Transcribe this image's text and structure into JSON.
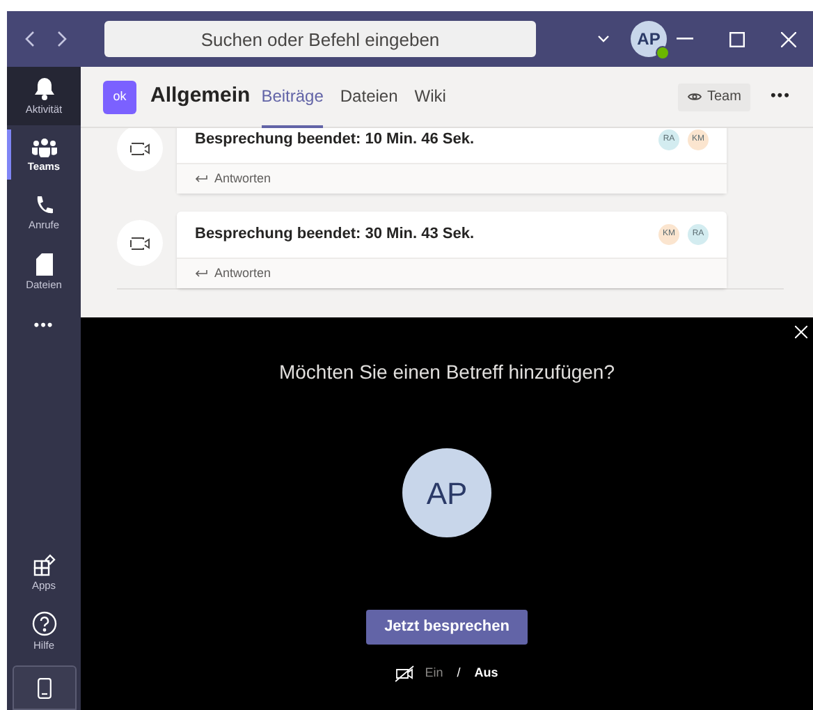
{
  "title_bar": {
    "search_placeholder": "Suchen oder Befehl eingeben",
    "avatar": "AP",
    "online": true
  },
  "sidebar": {
    "items": [
      {
        "kind": "bell",
        "label": "Aktivität",
        "selected": false,
        "hover": true
      },
      {
        "kind": "teams",
        "label": "Teams",
        "selected": true,
        "hover": false
      },
      {
        "kind": "phone",
        "label": "Anrufe",
        "selected": false,
        "hover": false
      },
      {
        "kind": "file",
        "label": "Dateien",
        "selected": false,
        "hover": false
      }
    ],
    "more": "•••",
    "bottom_items": [
      {
        "kind": "apps",
        "label": "Apps"
      },
      {
        "kind": "help",
        "label": "Hilfe"
      }
    ]
  },
  "channel": {
    "badge": "ok",
    "name": "Allgemein",
    "tabs": [
      {
        "label": "Beiträge",
        "selected": true
      },
      {
        "label": "Dateien",
        "selected": false
      },
      {
        "label": "Wiki",
        "selected": false
      }
    ],
    "team_button": "Team",
    "more": "•••"
  },
  "messages": [
    {
      "text": "Besprechung beendet: 10 Min. 46 Sek.",
      "reply": "Antworten",
      "participants": [
        {
          "initials": "RA",
          "color": "#d3ecf0"
        },
        {
          "initials": "KM",
          "color": "#fbe5cf"
        }
      ]
    },
    {
      "text": "Besprechung beendet: 30 Min. 43 Sek.",
      "reply": "Antworten",
      "participants": [
        {
          "initials": "KM",
          "color": "#fbe5cf"
        },
        {
          "initials": "RA",
          "color": "#d3ecf0"
        }
      ]
    }
  ],
  "overlay": {
    "question": "Möchten Sie einen Betreff hinzufügen?",
    "avatar": "AP",
    "button": "Jetzt besprechen",
    "camera": {
      "on_label": "Ein",
      "off_label": "Aus",
      "separator": "/",
      "on": false
    }
  }
}
